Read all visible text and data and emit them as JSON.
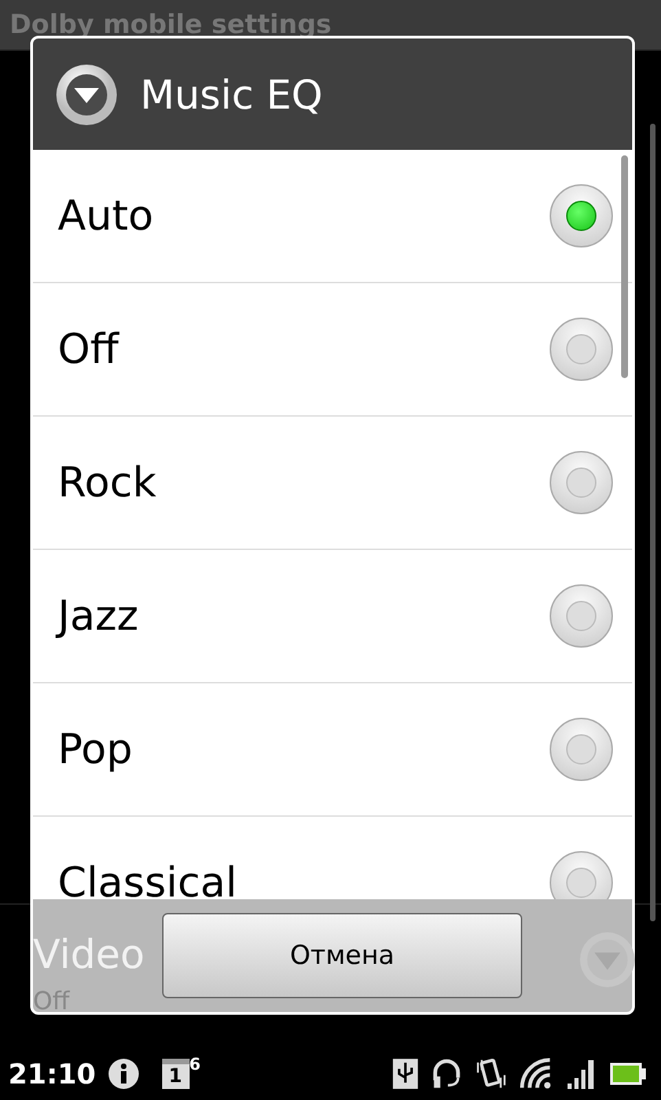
{
  "background": {
    "title": "Dolby mobile settings",
    "items": [
      {
        "title": "Video",
        "summary": "Off"
      }
    ]
  },
  "dialog": {
    "title": "Music EQ",
    "options": [
      {
        "label": "Auto",
        "selected": true
      },
      {
        "label": "Off",
        "selected": false
      },
      {
        "label": "Rock",
        "selected": false
      },
      {
        "label": "Jazz",
        "selected": false
      },
      {
        "label": "Pop",
        "selected": false
      },
      {
        "label": "Classical",
        "selected": false
      }
    ],
    "buttons": [
      "Отмена"
    ]
  },
  "status_bar": {
    "time": "21:10",
    "calendar_date": "1",
    "notification_count": "6"
  }
}
